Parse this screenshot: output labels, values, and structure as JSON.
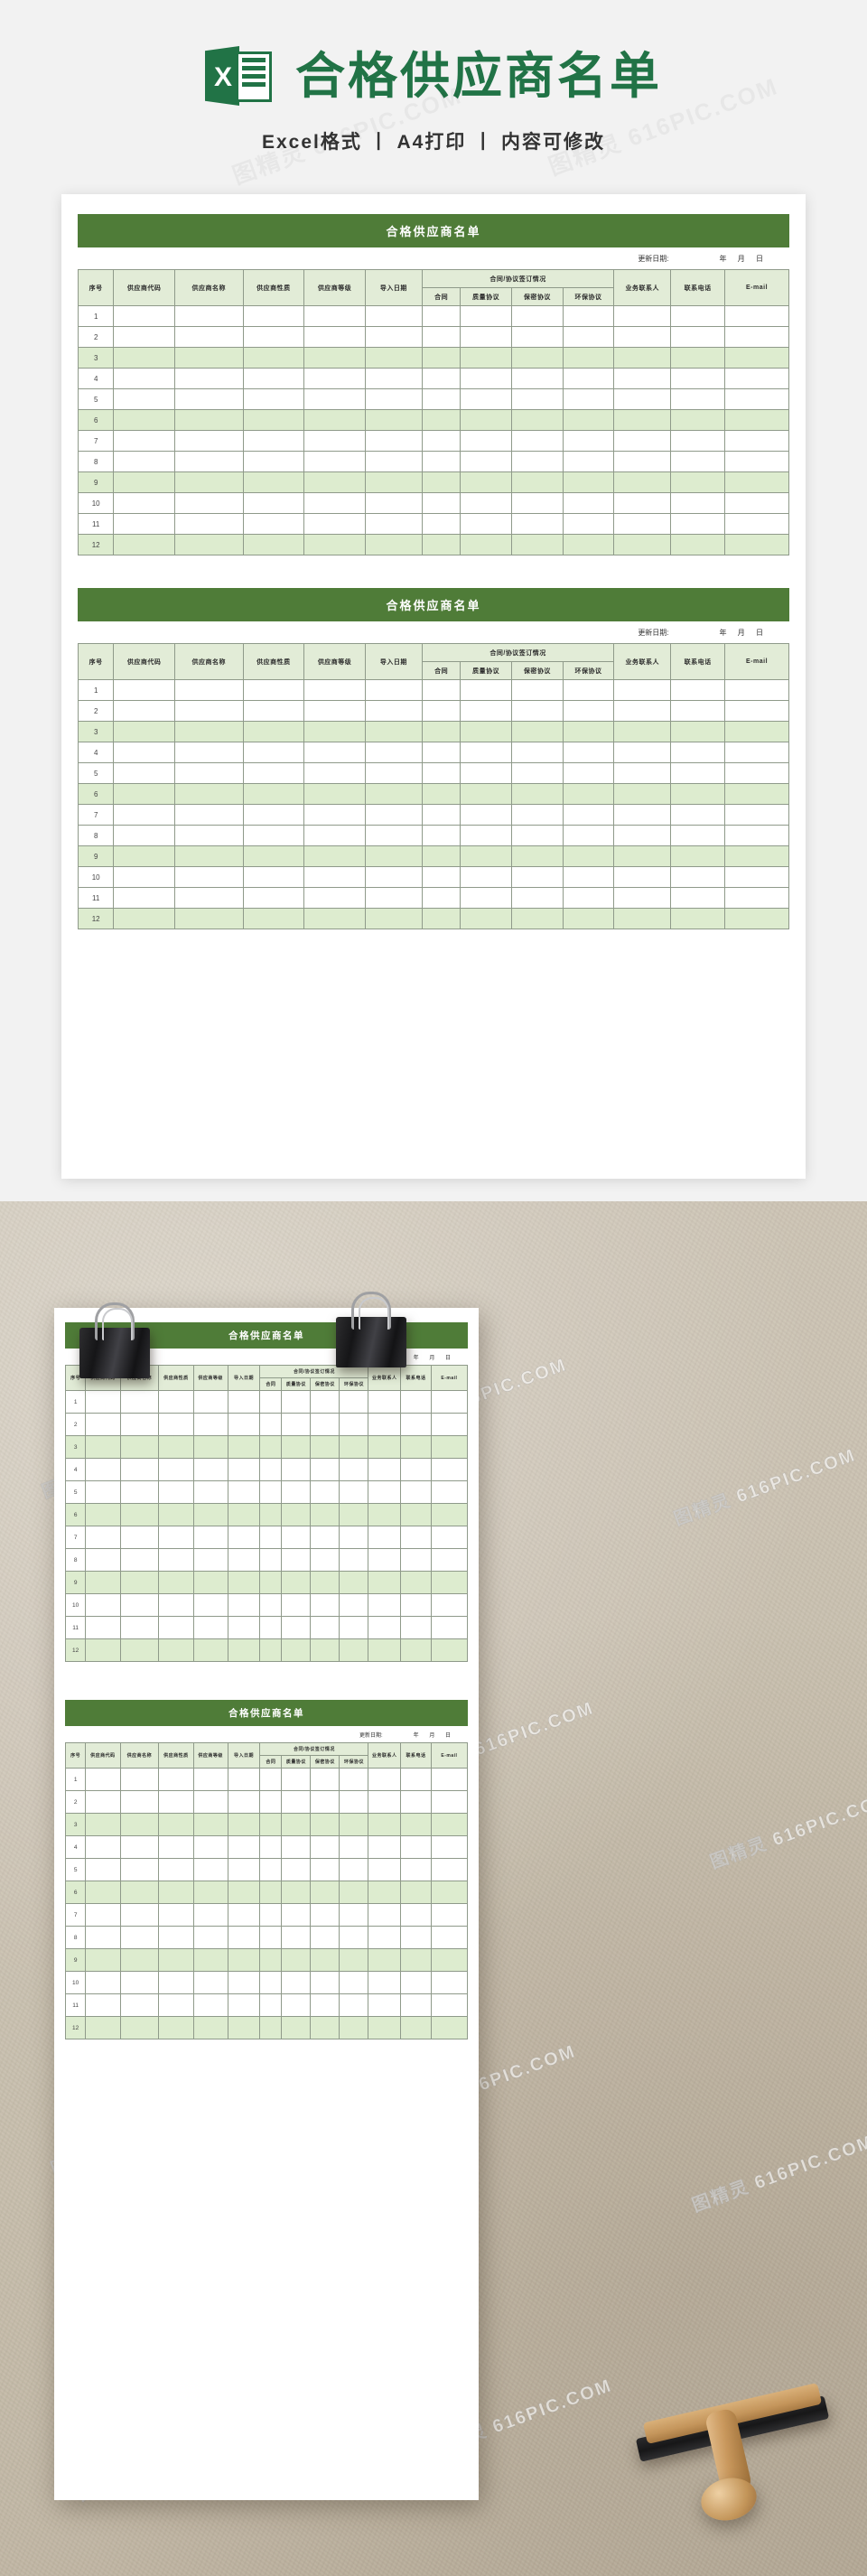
{
  "hero": {
    "logo_letter": "X",
    "title": "合格供应商名单",
    "subtitle": "Excel格式 丨 A4打印 丨 内容可修改"
  },
  "document": {
    "title": "合格供应商名单",
    "update_label": "更新日期:",
    "ymd": "年 月 日",
    "group_header": "合同/协议签订情况",
    "columns": [
      "序号",
      "供应商代码",
      "供应商名称",
      "供应商性质",
      "供应商等级",
      "导入日期",
      "合同",
      "质量协议",
      "保密协议",
      "环保协议",
      "业务联系人",
      "联系电话",
      "E-mail"
    ],
    "sub_columns": [
      "合同",
      "质量协议",
      "保密协议",
      "环保协议"
    ],
    "row_numbers": [
      "1",
      "2",
      "3",
      "4",
      "5",
      "6",
      "7",
      "8",
      "9",
      "10",
      "11",
      "12"
    ],
    "highlight_rows": [
      3,
      6,
      9,
      12
    ]
  },
  "watermark": {
    "text": "图精灵 616PIC.COM"
  },
  "colors": {
    "brand_green": "#217346",
    "table_header_green": "#4f7c38",
    "row_tint": "#ddeccf",
    "header_tint": "#e2ecd7"
  }
}
